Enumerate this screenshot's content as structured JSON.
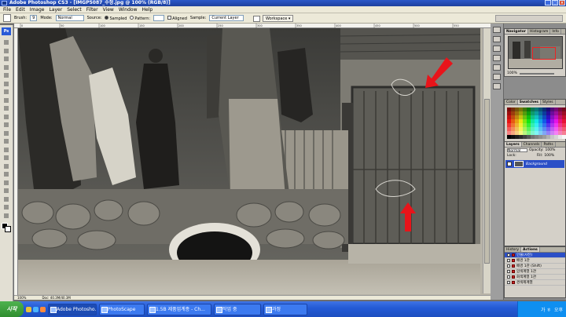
{
  "window": {
    "title": "Adobe Photoshop CS3 - [IMGP5087_수정.jpg @ 100% (RGB/8)]"
  },
  "menu": [
    "File",
    "Edit",
    "Image",
    "Layer",
    "Select",
    "Filter",
    "View",
    "Window",
    "Help"
  ],
  "options": {
    "brush_label": "Brush:",
    "brush_size": "9",
    "mode_label": "Mode:",
    "mode_value": "Normal",
    "source_label": "Source:",
    "sampled_label": "Sampled",
    "pattern_label": "Pattern:",
    "aligned_label": "Aligned",
    "sample_label": "Sample:",
    "sample_value": "Current Layer",
    "workspace_label": "Workspace ▾"
  },
  "canvas": {
    "ruler_ticks": [
      "0",
      "50",
      "100",
      "150",
      "200",
      "250",
      "300",
      "350",
      "400",
      "450",
      "500",
      "550"
    ],
    "status_zoom": "100%",
    "status_doc": "Doc: 40.3M/40.3M",
    "arrow_color": "#e8141a"
  },
  "panels": {
    "navigator_tabs": [
      "Navigator",
      "Histogram",
      "Info"
    ],
    "navigator_zoom": "100%",
    "color_tabs": [
      "Color",
      "Swatches",
      "Styles"
    ],
    "layers_tabs": [
      "Layers",
      "Channels",
      "Paths"
    ],
    "layers_mode": "Normal",
    "layers_opacity_label": "Opacity:",
    "layers_opacity": "100%",
    "layers_lock_label": "Lock:",
    "layers_fill_label": "Fill:",
    "layers_fill": "100%",
    "layer_name": "Background",
    "history_tabs": [
      "History",
      "Actions"
    ],
    "history_items": [
      "인물(사진)",
      "배경 1관",
      "배경 1관 (Shift)",
      "암색계열 1관",
      "회색계열 1관",
      "경색제계열"
    ]
  },
  "taskbar": {
    "start_label": "시작",
    "tasks": [
      "Adobe Photosho...",
      "PhotoScape",
      "1.5B 제품업계종 - Ch...",
      "작업 중",
      "과정"
    ],
    "tray_lang": "가 ㅎ",
    "clock": "오후"
  }
}
